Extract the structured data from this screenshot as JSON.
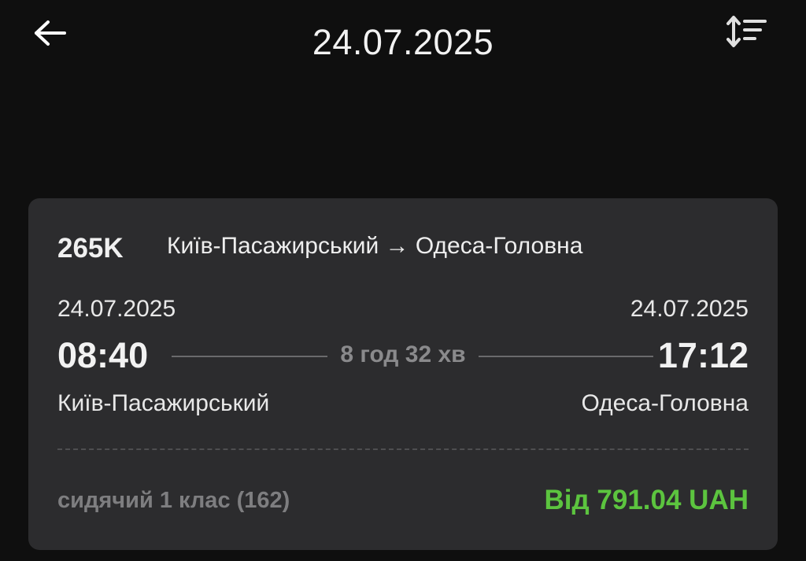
{
  "header": {
    "title": "24.07.2025",
    "back_icon": "arrow-left-icon",
    "sort_icon": "sort-icon"
  },
  "train": {
    "number": "265K",
    "route": "Київ-Пасажирський → Одеса-Головна",
    "departure": {
      "date": "24.07.2025",
      "time": "08:40",
      "station": "Київ-Пасажирський"
    },
    "arrival": {
      "date": "24.07.2025",
      "time": "17:12",
      "station": "Одеса-Головна"
    },
    "duration": "8 год 32 хв",
    "seat_class": "сидячий 1 клас (162)",
    "price": "Від 791.04 UAH"
  },
  "colors": {
    "background": "#0f0f0f",
    "card": "#2c2c2e",
    "price": "#5cc43f",
    "muted": "#7e7e80"
  }
}
